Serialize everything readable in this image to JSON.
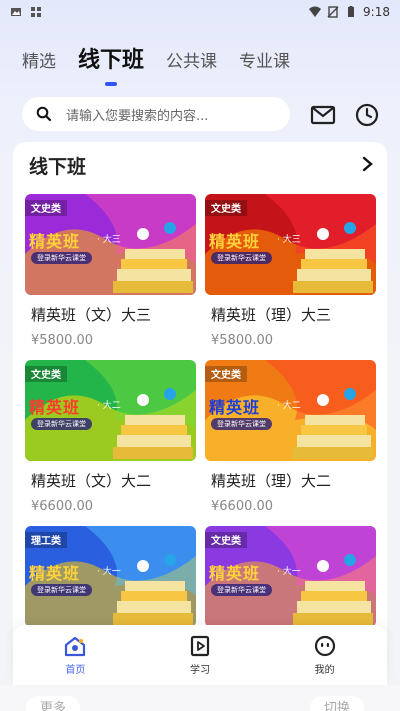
{
  "status_bar": {
    "time": "9:18"
  },
  "tabs": [
    {
      "label": "精选"
    },
    {
      "label": "线下班"
    },
    {
      "label": "公共课"
    },
    {
      "label": "专业课"
    }
  ],
  "search": {
    "placeholder": "请输入您要搜索的内容..."
  },
  "section": {
    "title": "线下班"
  },
  "courses": [
    {
      "category": "文史类",
      "headline": "精英班",
      "grade": "· 大三",
      "cta": "登录新华云课堂",
      "name": "精英班（文）大三",
      "price": "¥5800.00",
      "theme_color": "#9b2bd8"
    },
    {
      "category": "文史类",
      "headline": "精英班",
      "grade": "· 大三",
      "cta": "登录新华云课堂",
      "name": "精英班（理）大三",
      "price": "¥5800.00",
      "theme_color": "#c41419"
    },
    {
      "category": "文史类",
      "headline": "精英班",
      "grade": "· 大二",
      "cta": "登录新华云课堂",
      "name": "精英班（文）大二",
      "price": "¥6600.00",
      "theme_color": "#23b54a"
    },
    {
      "category": "文史类",
      "headline": "精英班",
      "grade": "· 大二",
      "cta": "登录新华云课堂",
      "name": "精英班（理）大二",
      "price": "¥6600.00",
      "theme_color": "#f07b14"
    },
    {
      "category": "理工类",
      "headline": "精英班",
      "grade": "· 大一",
      "cta": "登录新华云课堂",
      "name": "",
      "price": "",
      "theme_color": "#2a5fe0"
    },
    {
      "category": "文史类",
      "headline": "精英班",
      "grade": "· 大一",
      "cta": "登录新华云课堂",
      "name": "",
      "price": "",
      "theme_color": "#8a3ae0"
    }
  ],
  "bottom_nav": [
    {
      "label": "首页",
      "icon": "home-icon"
    },
    {
      "label": "学习",
      "icon": "play-book-icon"
    },
    {
      "label": "我的",
      "icon": "smile-face-icon"
    }
  ],
  "footer": {
    "more": "更多",
    "switch": "切换"
  },
  "colors": {
    "accent": "#2f56f2",
    "nav_active": "#4a68f0"
  }
}
